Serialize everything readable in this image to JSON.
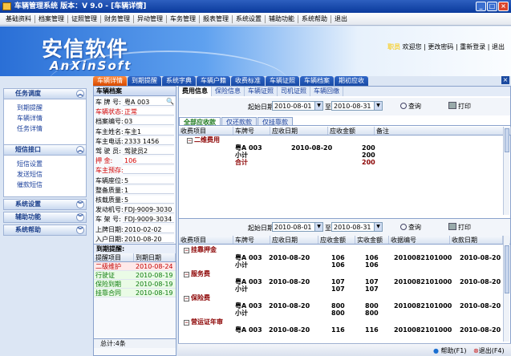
{
  "window": {
    "title": "车辆管理系统  版本：V 9.0 - [车辆详情]",
    "min": "_",
    "max": "□",
    "close": "×"
  },
  "menu": [
    "基础资料",
    "档案管理",
    "证照管理",
    "财务管理",
    "异动管理",
    "车务管理",
    "报表管理",
    "系统设置",
    "辅助功能",
    "系统帮助",
    "退出"
  ],
  "banner": {
    "logo_cn": "安信软件",
    "logo_en": "AnXinSoft",
    "role": "职员",
    "links": "欢迎您 | 更改密码 | 重新登录 | 退出"
  },
  "sidebar": {
    "task": {
      "title": "任务调度",
      "items": [
        "到期提醒",
        "车辆详情",
        "任务详情"
      ]
    },
    "sms": {
      "title": "短信接口",
      "items": [
        "短信设置",
        "发送短信",
        "催款短信"
      ]
    },
    "collapsed": [
      "系统设置",
      "辅助功能",
      "系统帮助"
    ]
  },
  "main_tabs": [
    "车辆详情",
    "到期提醒",
    "系统字典",
    "车辆户籍",
    "收费标准",
    "车辆证照",
    "车辆档案",
    "期初应收"
  ],
  "vehicle": {
    "panel_title": "车辆档案",
    "fields": [
      {
        "label": "车 牌 号:",
        "value": "粤A 003",
        "red": false
      },
      {
        "label": "车辆状态:",
        "value": "正常",
        "red": true
      },
      {
        "label": "档案编号:",
        "value": "03",
        "red": false
      },
      {
        "label": "车主姓名:",
        "value": "车主1",
        "red": false
      },
      {
        "label": "车主电话:",
        "value": "2333 1456",
        "red": false
      },
      {
        "label": "驾 驶 员:",
        "value": "驾驶员2",
        "red": false
      },
      {
        "label": "押    金:",
        "value": "106",
        "red": true
      },
      {
        "label": "车主预存:",
        "value": "",
        "red": true
      },
      {
        "label": "车辆座位:",
        "value": "5",
        "red": false
      },
      {
        "label": "整备质量:",
        "value": "1",
        "red": false
      },
      {
        "label": "核载质量:",
        "value": "5",
        "red": false
      },
      {
        "label": "发动机号:",
        "value": "FDJ-9009-3030",
        "red": false
      },
      {
        "label": "车 架 号:",
        "value": "FDJ-9009-3034",
        "red": false
      },
      {
        "label": "上牌日期:",
        "value": "2010-02-02",
        "red": false
      },
      {
        "label": "入户日期:",
        "value": "2010-08-20",
        "red": false
      }
    ],
    "remind_title": "到期提醒:",
    "remind_headers": [
      "提醒项目",
      "到期日期"
    ],
    "reminders": [
      {
        "item": "二级维护",
        "date": "2010-08-24",
        "style": "red"
      },
      {
        "item": "行驶证",
        "date": "2010-08-19",
        "style": "green"
      },
      {
        "item": "保险到期",
        "date": "2010-08-19",
        "style": "green"
      },
      {
        "item": "挂靠合同",
        "date": "2010-08-19",
        "style": "green"
      }
    ],
    "total": "总计:4条"
  },
  "detail_tabs": [
    "费用信息",
    "保险信息",
    "车辆证照",
    "司机证照",
    "车辆回缴"
  ],
  "filter": {
    "start_label": "起始日期",
    "start": "2010-08-01",
    "to": "至",
    "end": "2010-08-31",
    "query": "查询",
    "print": "打印"
  },
  "inner_tabs": [
    "全部应收款",
    "仅还款款",
    "仅挂靠款"
  ],
  "top_grid": {
    "headers": [
      "收费项目",
      "车牌号",
      "应收日期",
      "应收金额",
      "备注"
    ],
    "group": "二维费用",
    "rows": [
      {
        "plate": "粤A 003",
        "date": "2010-08-20",
        "amount": "200",
        "style": "normal"
      },
      {
        "plate": "小计",
        "date": "",
        "amount": "200",
        "style": "bold"
      },
      {
        "plate": "合计",
        "date": "",
        "amount": "200",
        "style": "total"
      }
    ]
  },
  "bottom_grid": {
    "headers": [
      "收费项目",
      "车牌号",
      "应收日期",
      "应收金额",
      "实收金额",
      "收据编号",
      "收款日期"
    ],
    "groups": [
      {
        "name": "挂靠押金",
        "rows": [
          {
            "plate": "粤A 003",
            "date": "2010-08-20",
            "due": "106",
            "paid": "106",
            "receipt": "2010082101000",
            "pdate": "2010-08-20"
          },
          {
            "plate": "小计",
            "date": "",
            "due": "106",
            "paid": "106",
            "receipt": "",
            "pdate": ""
          }
        ]
      },
      {
        "name": "服务费",
        "rows": [
          {
            "plate": "粤A 003",
            "date": "2010-08-20",
            "due": "107",
            "paid": "107",
            "receipt": "2010082101000",
            "pdate": "2010-08-20"
          },
          {
            "plate": "小计",
            "date": "",
            "due": "107",
            "paid": "107",
            "receipt": "",
            "pdate": ""
          }
        ]
      },
      {
        "name": "保险费",
        "rows": [
          {
            "plate": "粤A 003",
            "date": "2010-08-20",
            "due": "800",
            "paid": "800",
            "receipt": "2010082101000",
            "pdate": "2010-08-20"
          },
          {
            "plate": "小计",
            "date": "",
            "due": "800",
            "paid": "800",
            "receipt": "",
            "pdate": ""
          }
        ]
      },
      {
        "name": "营运证年审",
        "rows": [
          {
            "plate": "粤A 003",
            "date": "2010-08-20",
            "due": "116",
            "paid": "116",
            "receipt": "2010082101000",
            "pdate": "2010-08-20"
          }
        ]
      }
    ]
  },
  "status": {
    "help": "帮助(F1)",
    "exit": "退出(F4)"
  }
}
